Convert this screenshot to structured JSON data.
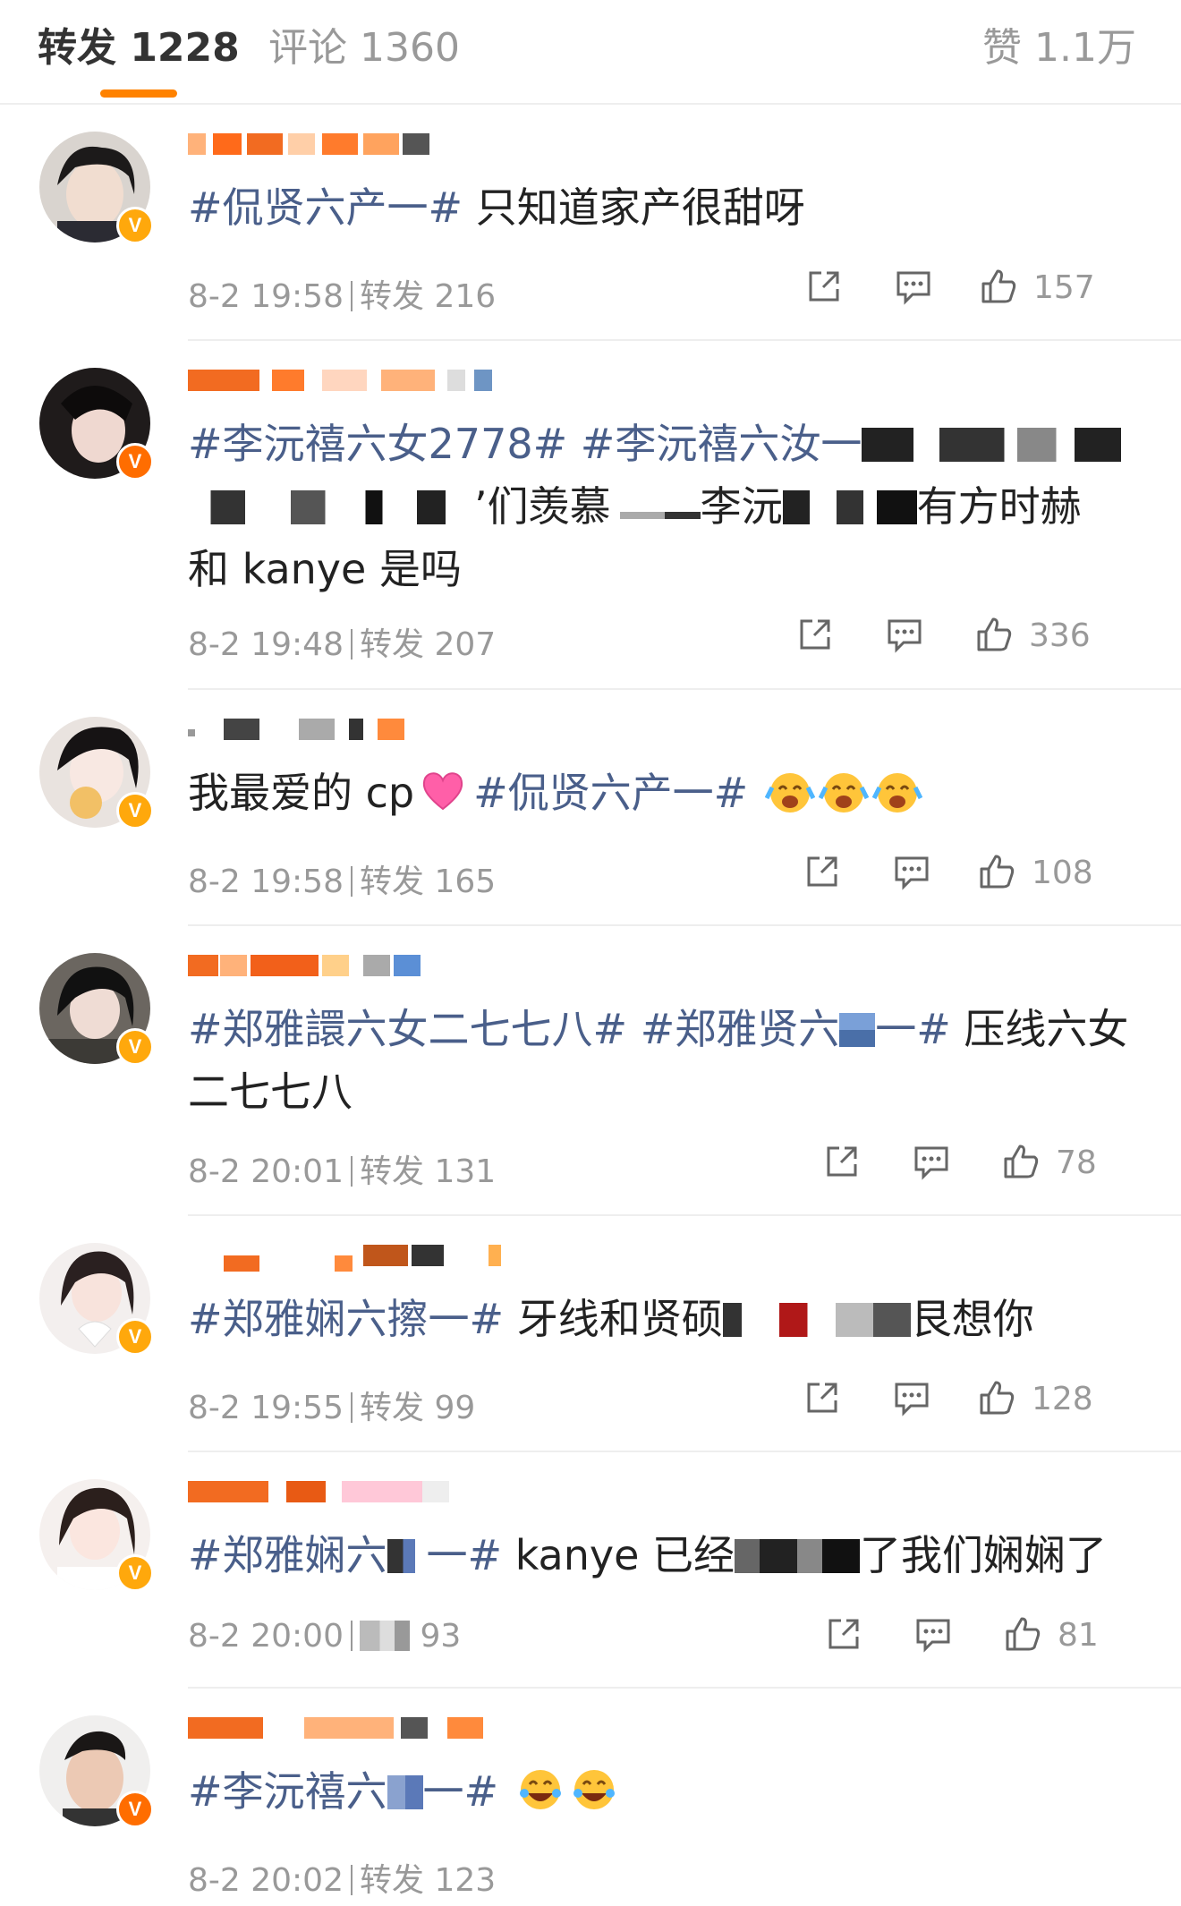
{
  "tabs": {
    "repost": "转发 1228",
    "comment": "评论 1360",
    "like": "赞 1.1万"
  },
  "posts": [
    {
      "segments": [
        "#侃贤六产一#",
        " 只知道家产很甜呀"
      ],
      "time": "8-2 19:58",
      "repost": "转发 216",
      "likes": "157"
    },
    {
      "segments": [
        "#李沅禧六女2778#",
        " ",
        "#李沅禧六汝一",
        "’们羡慕",
        "李沅",
        "有方时赫",
        "和 kanye 是吗"
      ],
      "time": "8-2 19:48",
      "repost": "转发 207",
      "likes": "336"
    },
    {
      "segments": [
        "我最爱的 cp",
        "#侃贤六产一#"
      ],
      "time": "8-2 19:58",
      "repost": "转发 165",
      "likes": "108"
    },
    {
      "segments": [
        "#郑雅譞六女二七七八#",
        " ",
        "#郑雅贤六",
        "一#",
        " 压线六女",
        "二七七八"
      ],
      "time": "8-2 20:01",
      "repost": "转发 131",
      "likes": "78"
    },
    {
      "segments": [
        "#郑雅娴六擦一#",
        " 牙线和贤硕",
        "艮想你"
      ],
      "time": "8-2 19:55",
      "repost": "转发 99",
      "likes": "128"
    },
    {
      "segments": [
        "#郑雅娴六",
        "一#",
        " kanye 已经",
        "了我们娴娴了"
      ],
      "time": "8-2 20:00",
      "repost": "93",
      "likes": "81"
    },
    {
      "segments": [
        "#李沅禧六",
        "一#"
      ],
      "time": "8-2 20:02",
      "repost": "转发 123",
      "likes": ""
    }
  ],
  "colors": {
    "accent": "#ff8200",
    "tag": "#4a5f8a",
    "meta": "#999999",
    "vip": "#ffa80c"
  },
  "icons": [
    "share-icon",
    "comment-icon",
    "like-icon",
    "verified-badge-icon"
  ]
}
